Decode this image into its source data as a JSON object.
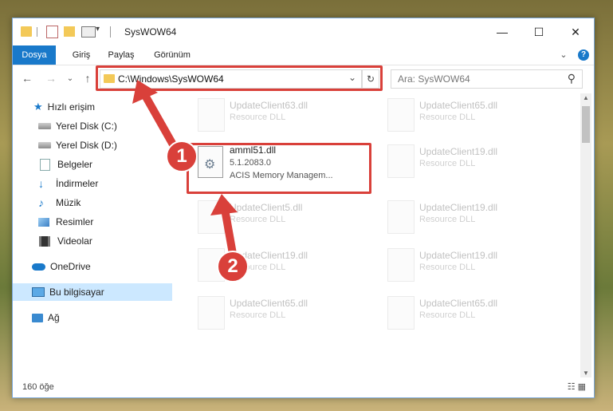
{
  "window": {
    "title": "SysWOW64",
    "controls": {
      "minimize": "—",
      "maximize": "☐",
      "close": "✕"
    }
  },
  "ribbon": {
    "tabs": [
      "Dosya",
      "Giriş",
      "Paylaş",
      "Görünüm"
    ],
    "expand": "⌄",
    "help": "?"
  },
  "navigation": {
    "back": "←",
    "forward": "→",
    "recent": "⌄",
    "up": "↑",
    "address": "C:\\Windows\\SysWOW64",
    "address_dropdown": "⌄",
    "refresh": "↻",
    "search_placeholder": "Ara: SysWOW64",
    "search_icon": "⚲"
  },
  "sidebar": {
    "items": [
      {
        "label": "Hızlı erişim",
        "icon": "star-icon",
        "pinned": false
      },
      {
        "label": "Yerel Disk (C:)",
        "icon": "drive-icon",
        "pinned": false
      },
      {
        "label": "Yerel Disk (D:)",
        "icon": "drive-icon",
        "pinned": true
      },
      {
        "label": "Belgeler",
        "icon": "document-icon",
        "pinned": true
      },
      {
        "label": "İndirmeler",
        "icon": "download-icon",
        "pinned": true
      },
      {
        "label": "Müzik",
        "icon": "music-icon",
        "pinned": true
      },
      {
        "label": "Resimler",
        "icon": "pictures-icon",
        "pinned": true
      },
      {
        "label": "Videolar",
        "icon": "video-icon",
        "pinned": true
      },
      {
        "label": "OneDrive",
        "icon": "cloud-icon",
        "pinned": false
      },
      {
        "label": "Bu bilgisayar",
        "icon": "computer-icon",
        "pinned": false,
        "selected": true
      },
      {
        "label": "Ağ",
        "icon": "network-icon",
        "pinned": false
      }
    ],
    "pin_glyph": "📌"
  },
  "files": [
    {
      "name": "UpdateClient63.dll",
      "desc": "Resource DLL",
      "faded": true
    },
    {
      "name": "UpdateClient65.dll",
      "desc": "Resource DLL",
      "faded": true
    },
    {
      "name": "amml51.dll",
      "line2": "5.1.2083.0",
      "line3": "ACIS Memory Managem...",
      "faded": false
    },
    {
      "name": "UpdateClient19.dll",
      "desc": "Resource DLL",
      "faded": true
    },
    {
      "name": "UpdateClient5.dll",
      "desc": "Resource DLL",
      "faded": true
    },
    {
      "name": "UpdateClient19.dll",
      "desc": "Resource DLL",
      "faded": true
    },
    {
      "name": "UpdateClient19.dll",
      "desc": "Resource DLL",
      "faded": true
    },
    {
      "name": "UpdateClient19.dll",
      "desc": "Resource DLL",
      "faded": true
    },
    {
      "name": "UpdateClient65.dll",
      "desc": "Resource DLL",
      "faded": true
    },
    {
      "name": "UpdateClient65.dll",
      "desc": "Resource DLL",
      "faded": true
    }
  ],
  "status": {
    "count": "160 öğe",
    "view_icons": "☷ ▦"
  },
  "annotations": {
    "badge1": "1",
    "badge2": "2",
    "accent": "#d9403a"
  }
}
